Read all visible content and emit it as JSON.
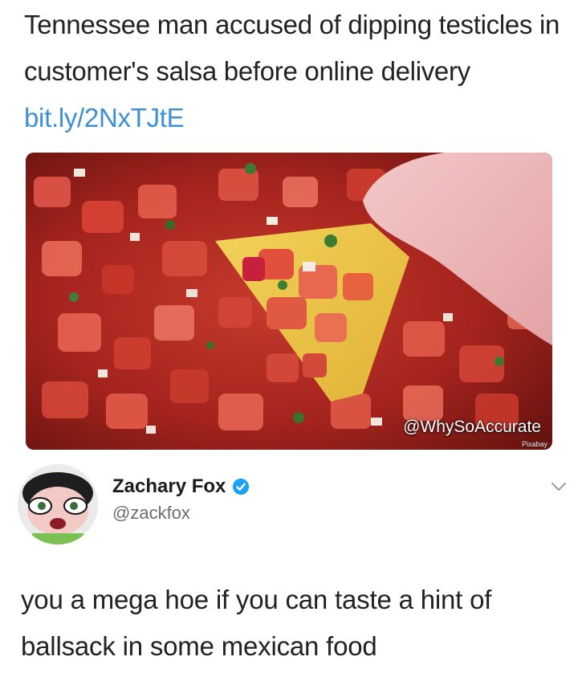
{
  "post": {
    "headline": "Tennessee man accused of dipping testicles in customer's salsa before online delivery",
    "link_text": "bit.ly/2NxTJtE",
    "image_watermark": "@WhySoAccurate",
    "image_credit": "Pixabay"
  },
  "tweet": {
    "display_name": "Zachary Fox",
    "handle": "@zackfox",
    "text": "you a mega hoe if you can taste a hint of ballsack in some mexican food",
    "verified": true
  },
  "icons": {
    "verified": "verified-badge-icon",
    "menu": "chevron-down-icon"
  },
  "colors": {
    "link": "#3d8fd6",
    "verified": "#1da1f2",
    "handle": "#6b6b6b"
  }
}
